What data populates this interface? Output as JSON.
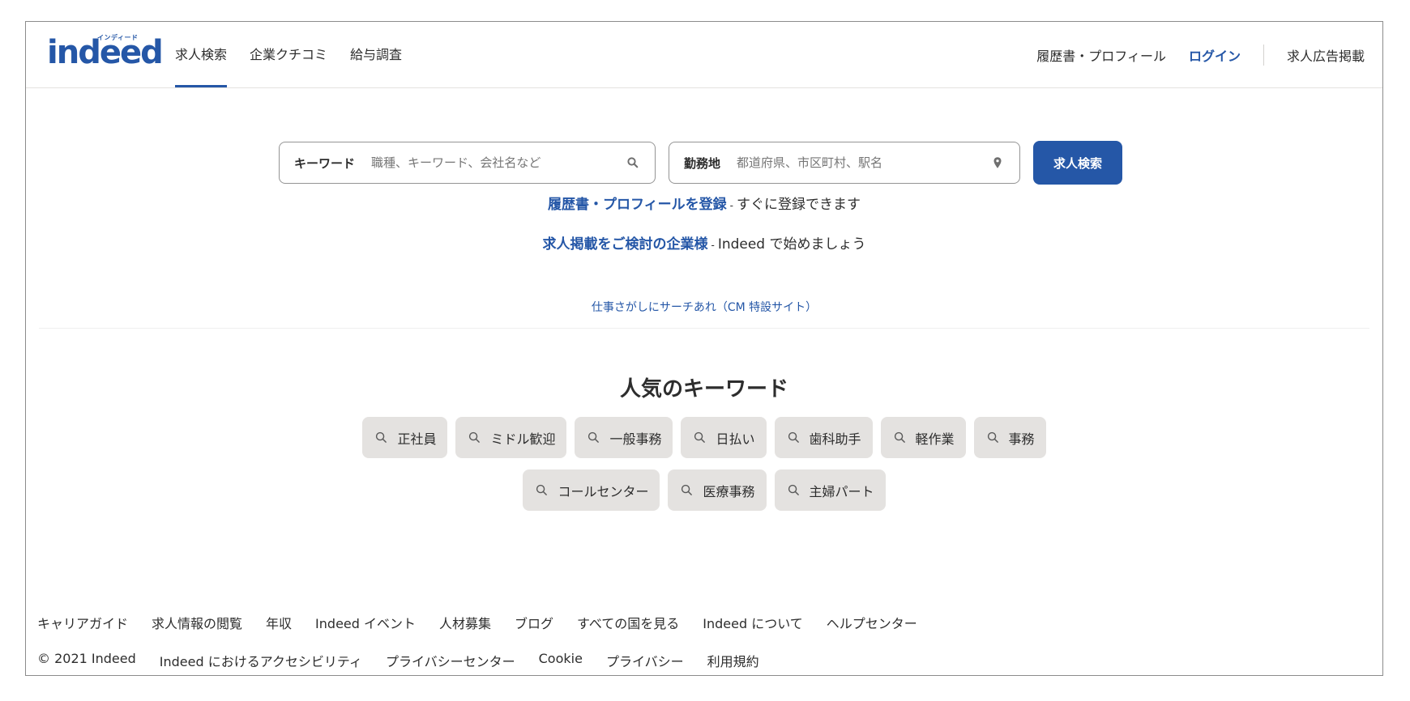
{
  "header": {
    "logo_sub": "インディード",
    "logo": "indeed",
    "tabs": [
      {
        "label": "求人検索",
        "active": true
      },
      {
        "label": "企業クチコミ",
        "active": false
      },
      {
        "label": "給与調査",
        "active": false
      }
    ],
    "resume_link": "履歴書・プロフィール",
    "login": "ログイン",
    "employers": "求人広告掲載"
  },
  "search": {
    "what_label": "キーワード",
    "what_placeholder": "職種、キーワード、会社名など",
    "what_value": "",
    "where_label": "勤務地",
    "where_placeholder": "都道府県、市区町村、駅名",
    "where_value": "",
    "button": "求人検索"
  },
  "promos": {
    "resume_link": "履歴書・プロフィールを登録",
    "resume_sep": "-",
    "resume_tail": "すぐに登録できます",
    "employer_link": "求人掲載をご検討の企業様",
    "employer_sep": "-",
    "employer_tail": "Indeed で始めましょう",
    "cm_link": "仕事さがしにサーチあれ（CM 特設サイト）"
  },
  "popular": {
    "title": "人気のキーワード",
    "row1": [
      "正社員",
      "ミドル歓迎",
      "一般事務",
      "日払い",
      "歯科助手",
      "軽作業",
      "事務"
    ],
    "row2": [
      "コールセンター",
      "医療事務",
      "主婦パート"
    ]
  },
  "footer": {
    "row1": [
      "キャリアガイド",
      "求人情報の閲覧",
      "年収",
      "Indeed イベント",
      "人材募集",
      "ブログ",
      "すべての国を見る",
      "Indeed について",
      "ヘルプセンター"
    ],
    "copyright": "© 2021 Indeed",
    "row2": [
      "Indeed におけるアクセシビリティ",
      "プライバシーセンター",
      "Cookie",
      "プライバシー",
      "利用規約"
    ]
  },
  "colors": {
    "brand": "#2557a7",
    "chip_bg": "#e4e2e0",
    "text": "#2d2d2d"
  }
}
